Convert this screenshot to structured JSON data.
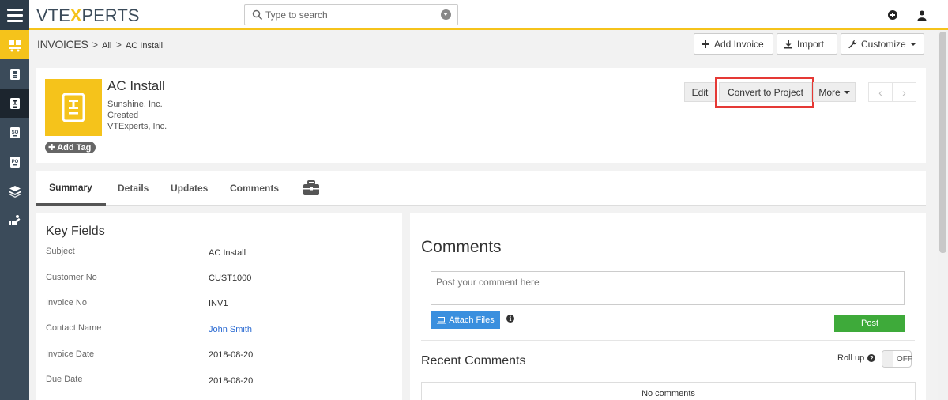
{
  "app": {
    "logo_prefix": "VTE",
    "logo_x": "X",
    "logo_suffix": "PERTS"
  },
  "search": {
    "placeholder": "Type to search"
  },
  "breadcrumb": {
    "module": "Invoices",
    "sep1": ">",
    "all": "All",
    "sep2": ">",
    "record": "AC Install"
  },
  "header_actions": {
    "add_invoice": "Add Invoice",
    "import": "Import",
    "customize": "Customize"
  },
  "record": {
    "title": "AC Install",
    "line1": "Sunshine, Inc.",
    "line2": "Created",
    "line3": "VTExperts, Inc.",
    "add_tag": "Add Tag",
    "actions": {
      "edit": "Edit",
      "convert": "Convert to Project",
      "more": "More"
    }
  },
  "tabs": [
    {
      "label": "Summary",
      "active": true
    },
    {
      "label": "Details"
    },
    {
      "label": "Updates"
    },
    {
      "label": "Comments"
    }
  ],
  "key_fields": {
    "title": "Key Fields",
    "rows": [
      {
        "label": "Subject",
        "value": "AC Install"
      },
      {
        "label": "Customer No",
        "value": "CUST1000"
      },
      {
        "label": "Invoice No",
        "value": "INV1"
      },
      {
        "label": "Contact Name",
        "value": "John Smith"
      },
      {
        "label": "Invoice Date",
        "value": "2018-08-20"
      },
      {
        "label": "Due Date",
        "value": "2018-08-20"
      }
    ]
  },
  "comments": {
    "title": "Comments",
    "placeholder": "Post your comment here",
    "attach": "Attach Files",
    "post": "Post",
    "recent_title": "Recent Comments",
    "rollup_label": "Roll up",
    "toggle_state": "OFF",
    "empty": "No comments"
  },
  "colors": {
    "accent": "#f5c31b",
    "sidebar": "#3b4b5a",
    "highlight": "#e53935",
    "post": "#3eaa3a",
    "attach": "#3a8fde",
    "link": "#2a6ad2"
  }
}
